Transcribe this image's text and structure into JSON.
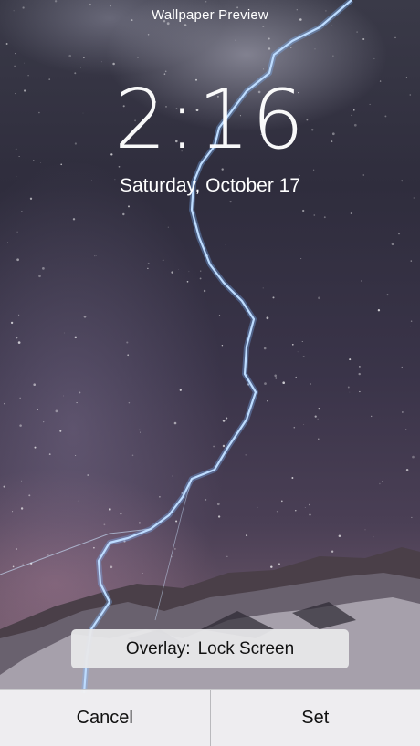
{
  "header": {
    "title": "Wallpaper Preview"
  },
  "lock_screen": {
    "time": "2:16",
    "date": "Saturday, October 17"
  },
  "overlay_button": {
    "prefix": "Overlay:",
    "value": "Lock Screen"
  },
  "actions": {
    "cancel_label": "Cancel",
    "set_label": "Set"
  },
  "colors": {
    "sky_top": "#3a3a48",
    "sky_bottom": "#7a6a7a",
    "lightning": "#bfe0ff",
    "button_bg": "#e8e8ea",
    "bar_bg": "#f0f0f2"
  }
}
